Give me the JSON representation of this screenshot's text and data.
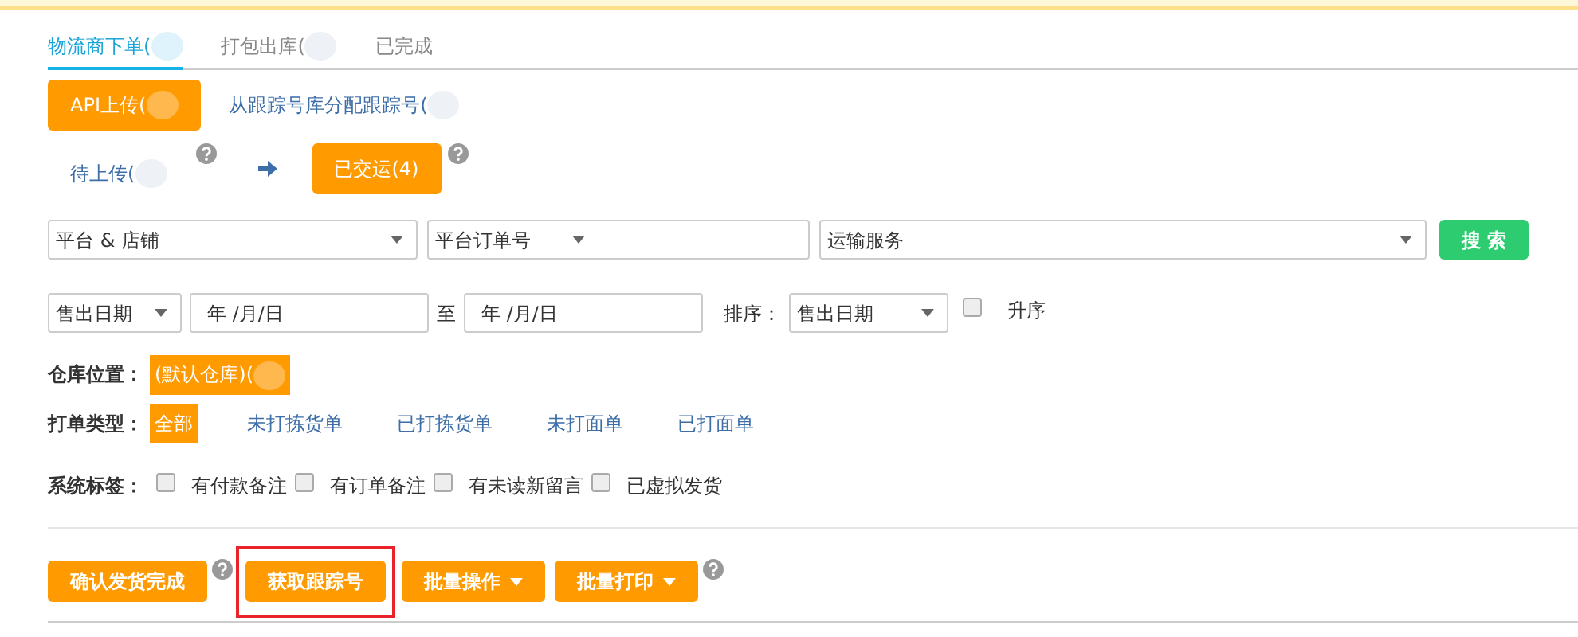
{
  "tabs": [
    {
      "label": "物流商下单(",
      "selected": true,
      "redacted": true
    },
    {
      "label": "打包出库(",
      "selected": false,
      "redacted": true
    },
    {
      "label": "已完成",
      "selected": false,
      "redacted": false
    }
  ],
  "upload_modes": [
    {
      "label": "API上传(",
      "selected": true,
      "redacted": true
    },
    {
      "label": "从跟踪号库分配跟踪号(",
      "selected": false,
      "redacted": true
    }
  ],
  "status_steps": [
    {
      "label": "待上传(",
      "selected": false,
      "redacted": true,
      "help": true
    },
    {
      "label": "已交运(4)",
      "selected": true,
      "redacted": false,
      "help": true
    }
  ],
  "filters": {
    "platform_store": "平台 & 店铺",
    "order_field": "平台订单号",
    "shipping_service": "运输服务",
    "search_button": "搜 索",
    "date_type": "售出日期",
    "date_from_placeholder": "年 /月/日",
    "range_separator": "至",
    "date_to_placeholder": "年 /月/日",
    "sort_label": "排序：",
    "sort_by": "售出日期",
    "ascending": {
      "label": "升序",
      "checked": false
    }
  },
  "warehouse": {
    "label": "仓库位置：",
    "options": [
      {
        "label": "(默认仓库)(",
        "selected": true,
        "redacted": true
      }
    ]
  },
  "print_type": {
    "label": "打单类型：",
    "options": [
      {
        "label": "全部",
        "selected": true
      },
      {
        "label": "未打拣货单",
        "selected": false
      },
      {
        "label": "已打拣货单",
        "selected": false
      },
      {
        "label": "未打面单",
        "selected": false
      },
      {
        "label": "已打面单",
        "selected": false
      }
    ]
  },
  "system_tags": {
    "label": "系统标签：",
    "options": [
      {
        "label": "有付款备注",
        "checked": false
      },
      {
        "label": "有订单备注",
        "checked": false
      },
      {
        "label": "有未读新留言",
        "checked": false
      },
      {
        "label": "已虚拟发货",
        "checked": false
      }
    ]
  },
  "actions": [
    {
      "label": "确认发货完成",
      "kind": "button",
      "help": true,
      "highlighted": false
    },
    {
      "label": "获取跟踪号",
      "kind": "button",
      "help": false,
      "highlighted": true
    },
    {
      "label": "批量操作",
      "kind": "dropdown",
      "help": false,
      "highlighted": false
    },
    {
      "label": "批量打印",
      "kind": "dropdown",
      "help": true,
      "highlighted": false
    }
  ]
}
